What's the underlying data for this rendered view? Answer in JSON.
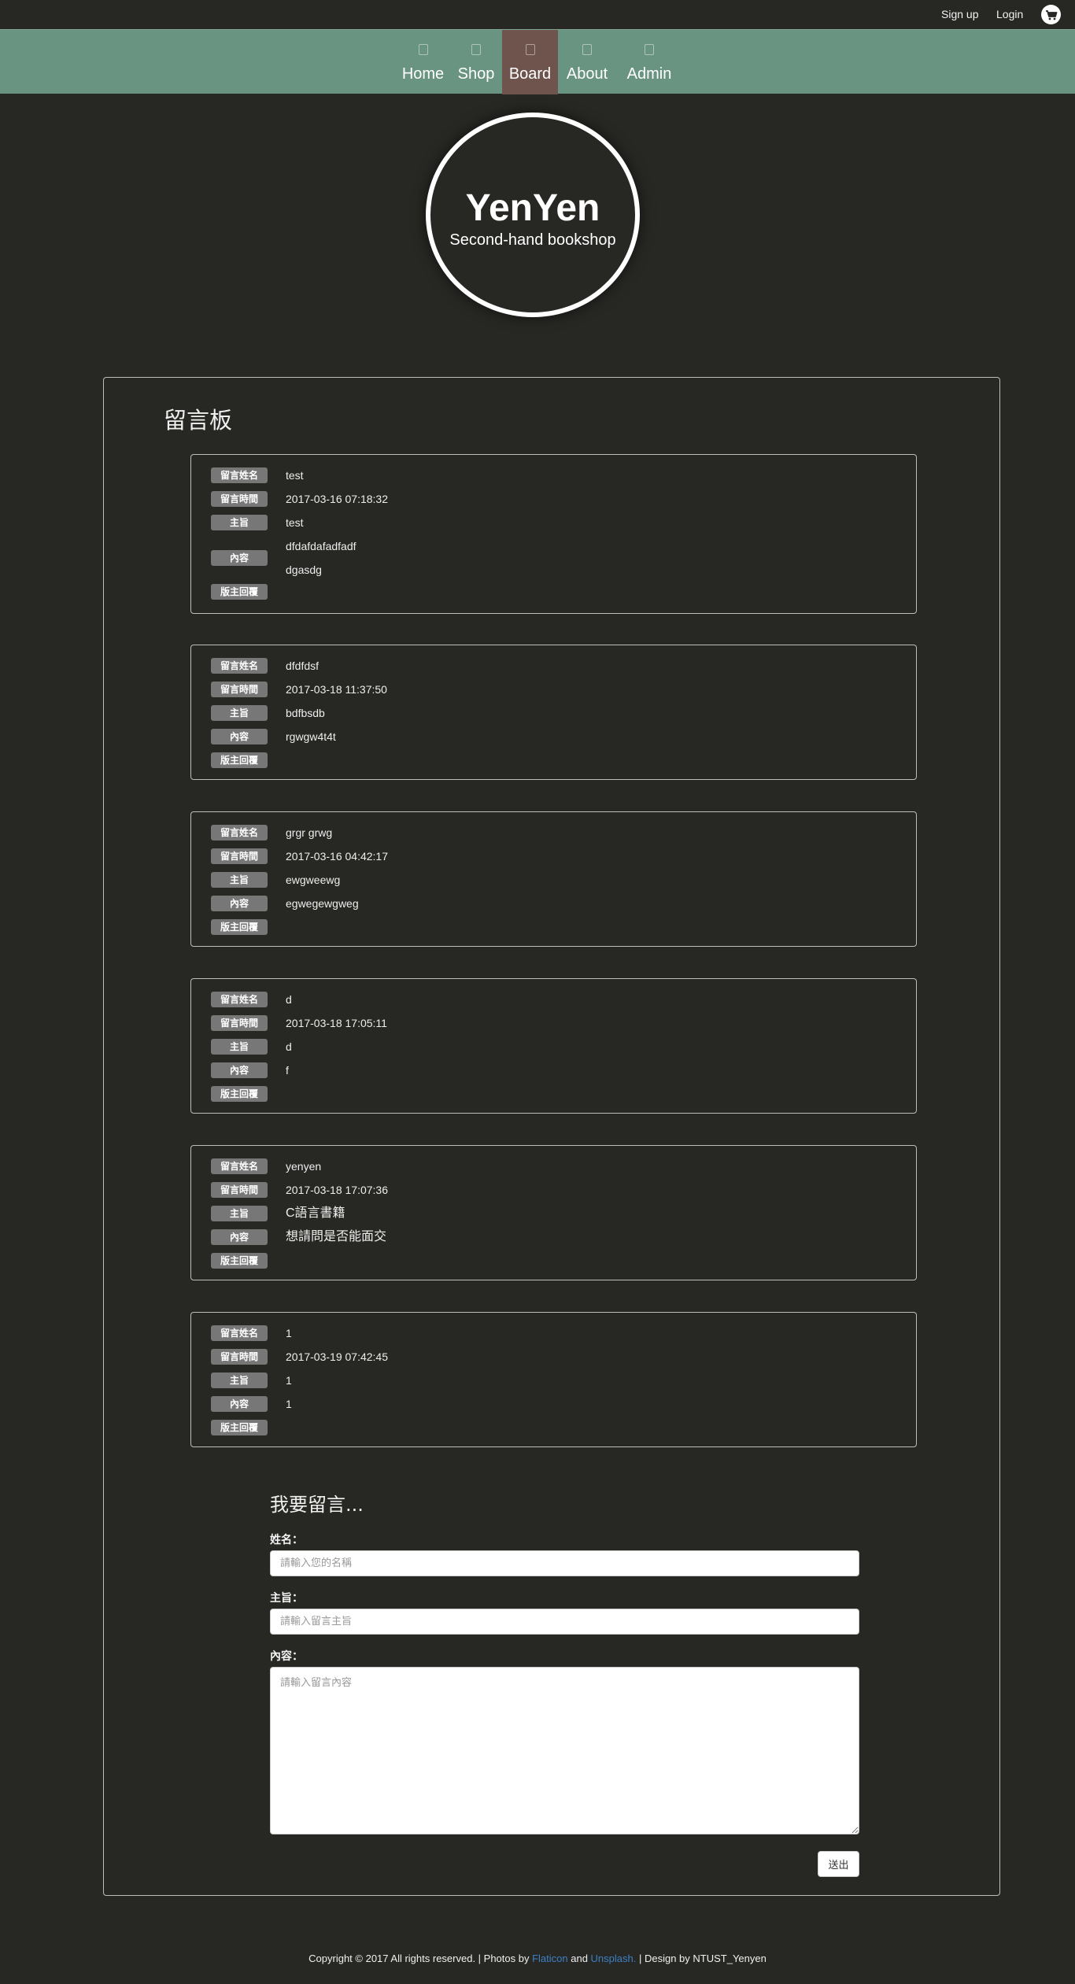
{
  "topbar": {
    "signup_label": "Sign up",
    "login_label": "Login",
    "cart_icon": "cart-icon"
  },
  "nav": {
    "items": [
      {
        "label": "Home",
        "active": false
      },
      {
        "label": "Shop",
        "active": false
      },
      {
        "label": "Board",
        "active": true
      },
      {
        "label": "About",
        "active": false
      },
      {
        "label": "Admin",
        "active": false
      }
    ]
  },
  "logo": {
    "brand": "YenYen",
    "tagline": "Second-hand bookshop"
  },
  "board": {
    "title": "留言板",
    "labels": {
      "name": "留言姓名",
      "time": "留言時間",
      "subject": "主旨",
      "content": "內容",
      "reply": "版主回覆"
    },
    "messages": [
      {
        "name": "test",
        "time": "2017-03-16 07:18:32",
        "subject": "test",
        "content": [
          "dfdafdafadfadf",
          "dgasdg"
        ],
        "reply": ""
      },
      {
        "name": "dfdfdsf",
        "time": "2017-03-18 11:37:50",
        "subject": "bdfbsdb",
        "content": [
          "rgwgw4t4t"
        ],
        "reply": ""
      },
      {
        "name": "grgr grwg",
        "time": "2017-03-16 04:42:17",
        "subject": "ewgweewg",
        "content": [
          "egwegewgweg"
        ],
        "reply": ""
      },
      {
        "name": "d",
        "time": "2017-03-18 17:05:11",
        "subject": "d",
        "content": [
          "f"
        ],
        "reply": ""
      },
      {
        "name": "yenyen",
        "time": "2017-03-18 17:07:36",
        "subject": "C語言書籍",
        "content": [
          "想請問是否能面交"
        ],
        "reply": ""
      },
      {
        "name": "1",
        "time": "2017-03-19 07:42:45",
        "subject": "1",
        "content": [
          "1"
        ],
        "reply": ""
      }
    ]
  },
  "form": {
    "title": "我要留言...",
    "name_label": "姓名：",
    "name_placeholder": "請輸入您的名稱",
    "subject_label": "主旨：",
    "subject_placeholder": "請輸入留言主旨",
    "content_label": "內容：",
    "content_placeholder": "請輸入留言內容",
    "submit_label": "送出"
  },
  "footer": {
    "prefix": "Copyright © 2017 All rights reserved. | Photos by ",
    "flaticon": "Flaticon",
    "and": " and ",
    "unsplash": "Unsplash.",
    "suffix": " | Design by NTUST_Yenyen"
  }
}
